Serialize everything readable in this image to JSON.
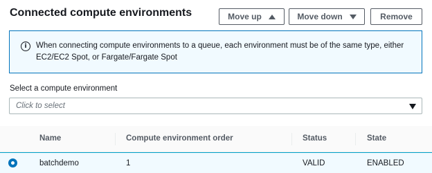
{
  "header": {
    "title": "Connected compute environments",
    "buttons": {
      "move_up": "Move up",
      "move_down": "Move down",
      "remove": "Remove"
    }
  },
  "alert": {
    "icon": "info-icon",
    "text": "When connecting compute environments to a queue, each environment must be of the same type, either EC2/EC2 Spot, or Fargate/Fargate Spot"
  },
  "select": {
    "label": "Select a compute environment",
    "placeholder": "Click to select"
  },
  "table": {
    "columns": [
      "Name",
      "Compute environment order",
      "Status",
      "State"
    ],
    "rows": [
      {
        "selected": true,
        "name": "batchdemo",
        "order": "1",
        "status": "VALID",
        "state": "ENABLED"
      }
    ]
  },
  "colors": {
    "accent": "#0073bb",
    "alert_background": "#f1faff",
    "text": "#16191f",
    "secondary_text": "#545b64"
  }
}
